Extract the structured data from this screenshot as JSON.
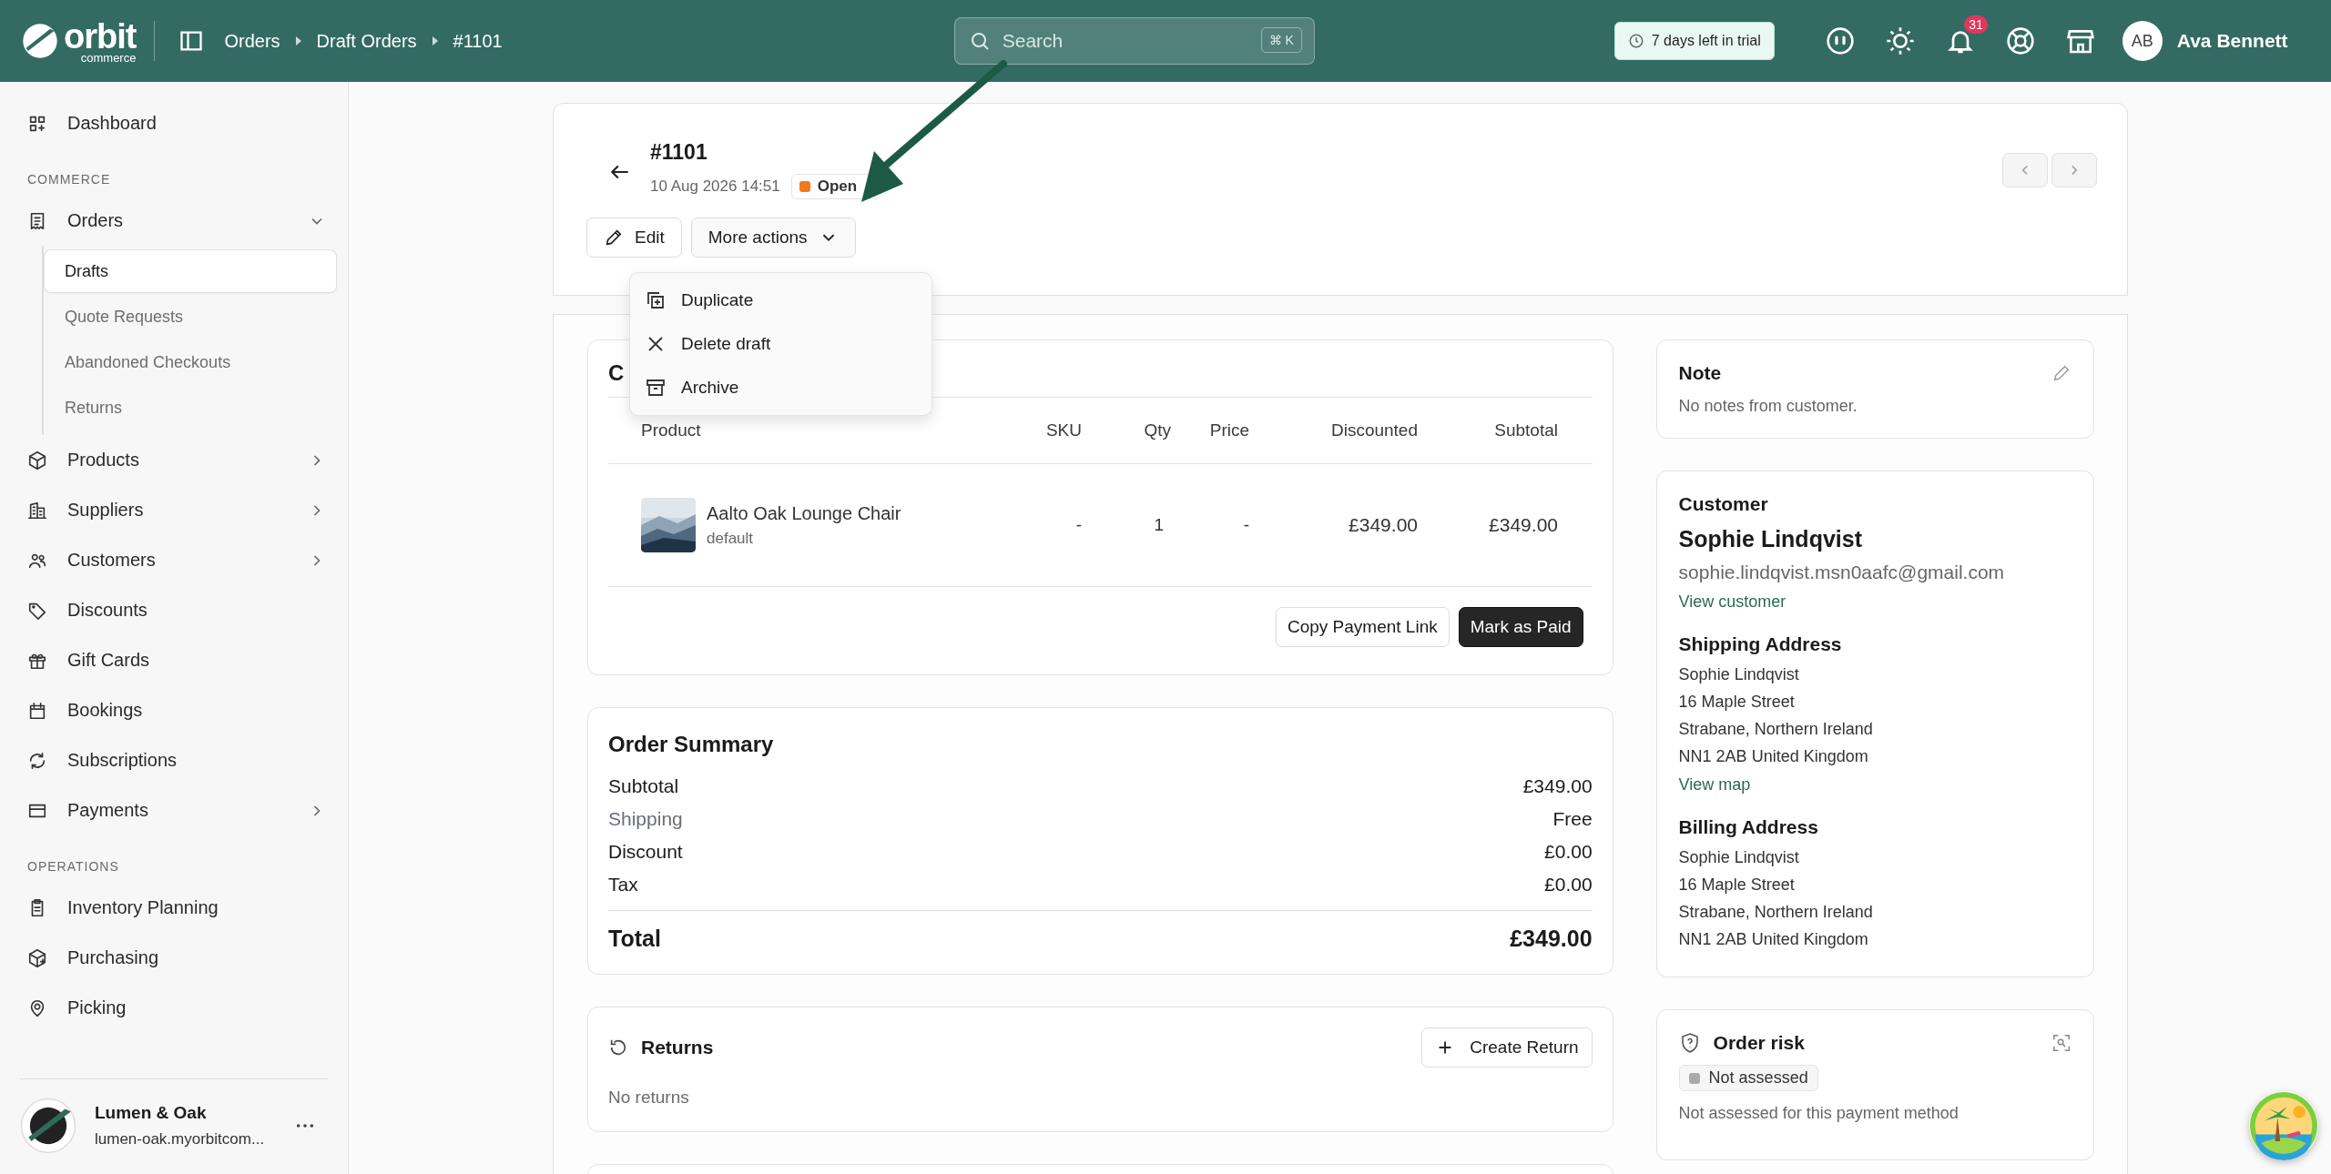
{
  "header": {
    "logo": {
      "name": "orbit",
      "tagline": "commerce"
    },
    "breadcrumbs": [
      "Orders",
      "Draft Orders",
      "#1101"
    ],
    "search": {
      "placeholder": "Search",
      "shortcut": "⌘ K"
    },
    "trial_badge": "7 days left in trial",
    "notifications_count": "31",
    "user": {
      "initials": "AB",
      "name": "Ava Bennett"
    }
  },
  "sidebar": {
    "items": [
      {
        "kind": "link",
        "label": "Dashboard"
      },
      {
        "kind": "heading",
        "label": "COMMERCE"
      },
      {
        "kind": "link",
        "label": "Orders",
        "expanded": true,
        "children": [
          {
            "label": "Drafts",
            "selected": true
          },
          {
            "label": "Quote Requests",
            "selected": false
          },
          {
            "label": "Abandoned Checkouts",
            "selected": false
          },
          {
            "label": "Returns",
            "selected": false
          }
        ]
      },
      {
        "kind": "link",
        "label": "Products",
        "expanded": false
      },
      {
        "kind": "link",
        "label": "Suppliers",
        "expanded": false
      },
      {
        "kind": "link",
        "label": "Customers",
        "expanded": false
      },
      {
        "kind": "link",
        "label": "Discounts"
      },
      {
        "kind": "link",
        "label": "Gift Cards"
      },
      {
        "kind": "link",
        "label": "Bookings"
      },
      {
        "kind": "link",
        "label": "Subscriptions"
      },
      {
        "kind": "link",
        "label": "Payments",
        "expanded": false
      },
      {
        "kind": "heading",
        "label": "OPERATIONS"
      },
      {
        "kind": "link",
        "label": "Inventory Planning"
      },
      {
        "kind": "link",
        "label": "Purchasing"
      },
      {
        "kind": "link",
        "label": "Picking"
      }
    ],
    "store": {
      "name": "Lumen & Oak",
      "domain": "lumen-oak.myorbitcom..."
    }
  },
  "order": {
    "number": "#1101",
    "date": "10 Aug 2026 14:51",
    "status": "Open",
    "actions": [
      {
        "label": "Edit"
      },
      {
        "label": "More actions",
        "expanded": true
      }
    ],
    "menu": [
      "Duplicate",
      "Delete draft",
      "Archive"
    ]
  },
  "items_card": {
    "title": "C",
    "columns": [
      "Product",
      "SKU",
      "Qty",
      "Price",
      "Discounted",
      "Subtotal"
    ],
    "rows": [
      {
        "name": "Aalto Oak Lounge Chair",
        "variant": "default",
        "sku": "-",
        "qty": "1",
        "price": "-",
        "discounted": "£349.00",
        "subtotal": "£349.00"
      }
    ],
    "buttons": [
      {
        "label": "Copy Payment Link",
        "kind": "secondary"
      },
      {
        "label": "Mark as Paid",
        "kind": "primary"
      }
    ]
  },
  "summary": {
    "title": "Order Summary",
    "lines": [
      {
        "label": "Subtotal",
        "value": "£349.00",
        "muted": false
      },
      {
        "label": "Shipping",
        "value": "Free",
        "muted": true
      },
      {
        "label": "Discount",
        "value": "£0.00",
        "muted": false
      },
      {
        "label": "Tax",
        "value": "£0.00",
        "muted": false
      }
    ],
    "total": {
      "label": "Total",
      "value": "£349.00"
    }
  },
  "returns": {
    "title": "Returns",
    "button": "Create Return",
    "empty": "No returns"
  },
  "note": {
    "title": "Note",
    "text": "No notes from customer."
  },
  "customer": {
    "title": "Customer",
    "name": "Sophie Lindqvist",
    "email": "sophie.lindqvist.msn0aafc@gmail.com",
    "link": "View customer",
    "shipping": {
      "title": "Shipping Address",
      "lines": [
        "Sophie Lindqvist",
        "16 Maple Street",
        "Strabane, Northern Ireland",
        "NN1 2AB United Kingdom"
      ],
      "link": "View map"
    },
    "billing": {
      "title": "Billing Address",
      "lines": [
        "Sophie Lindqvist",
        "16 Maple Street",
        "Strabane, Northern Ireland",
        "NN1 2AB United Kingdom"
      ]
    }
  },
  "risk": {
    "title": "Order risk",
    "badge": "Not assessed",
    "text": "Not assessed for this payment method"
  }
}
